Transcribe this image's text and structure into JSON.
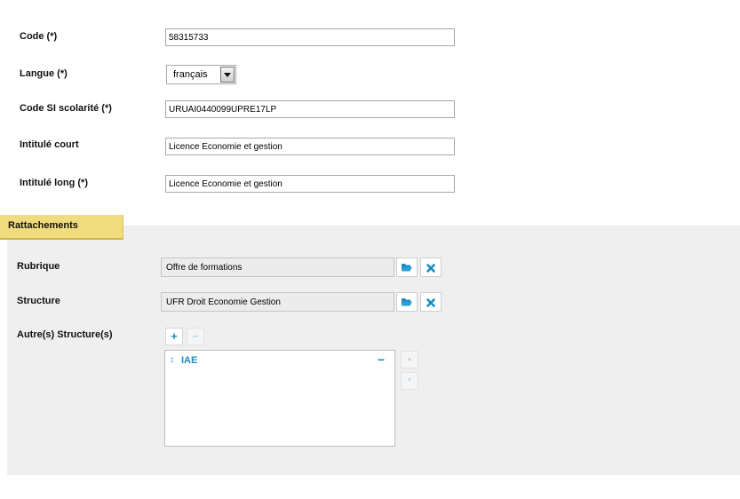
{
  "form": {
    "code": {
      "label": "Code (*)",
      "value": "58315733"
    },
    "langue": {
      "label": "Langue  (*)",
      "value": "français"
    },
    "code_si": {
      "label": "Code SI scolarité (*)",
      "value": "URUAI0440099UPRE17LP"
    },
    "intitule_court": {
      "label": "Intitulé court",
      "value": "Licence Economie et gestion"
    },
    "intitule_long": {
      "label": "Intitulé long (*)",
      "value": "Licence Economie et gestion"
    }
  },
  "section": {
    "tab_label": "Rattachements"
  },
  "rattachements": {
    "rubrique": {
      "label": "Rubrique",
      "value": "Offre de formations"
    },
    "structure": {
      "label": "Structure",
      "value": "UFR Droit Economie Gestion"
    },
    "autres": {
      "label": "Autre(s) Structure(s)",
      "add_symbol": "+",
      "remove_symbol": "−",
      "items": [
        {
          "drag_symbol": "↕",
          "label": "IAE",
          "remove_symbol": "−"
        }
      ],
      "up_symbol": "▲",
      "down_symbol": "▼"
    }
  },
  "colors": {
    "tab_bg": "#f0dc7e",
    "panel_bg": "#efefef",
    "accent": "#1a8bc0"
  },
  "icons": {
    "browse": "folder-open-icon",
    "clear": "close-icon"
  }
}
